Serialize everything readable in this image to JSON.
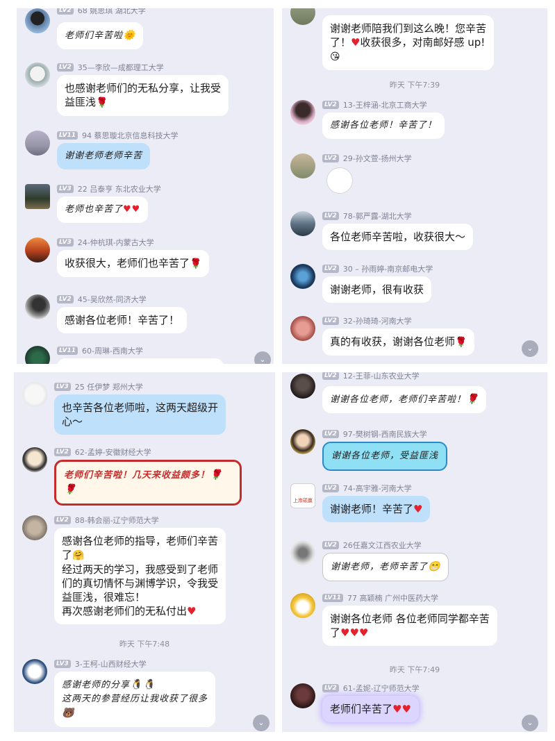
{
  "icons": {
    "heart": "♥",
    "rose": "🌹",
    "chevron": "⌄"
  },
  "panels": [
    {
      "messages": [
        {
          "level": "LV2",
          "name": "68 姚思琪 湖北大学",
          "text": "老师们辛苦啦",
          "emoji": "🌞"
        },
        {
          "level": "LV2",
          "name": "35—李欣—成都理工大学",
          "text": "也感谢老师们的无私分享，让我受\n益匪浅"
        },
        {
          "level": "LV11",
          "name": "94 蔡思璇北京信息科技大学",
          "text": "谢谢老师老师辛苦"
        },
        {
          "level": "LV3",
          "name": "22 吕泰亨 东北农业大学",
          "text": "老师也辛苦了"
        },
        {
          "level": "LV3",
          "name": "24-仲杭琪-内蒙古大学",
          "text": "收获很大，老师们也辛苦了"
        },
        {
          "level": "LV2",
          "name": "45-吴欣然-同济大学",
          "text": "感谢各位老师！辛苦了！"
        },
        {
          "level": "LV11",
          "name": "60-周琳-西南大学",
          "text": ""
        }
      ]
    },
    {
      "messages": [
        {
          "text": "谢谢老师陪我们到这么晚！您辛苦\n了！",
          "text2": "收获很多，对南邮好感 up!",
          "emoji": "😘"
        },
        {
          "level": "LV2",
          "name": "13-王梓涵-北京工商大学",
          "text": "感谢各位老师！辛苦了！"
        },
        {
          "level": "LV2",
          "name": "29-孙文萱-扬州大学",
          "text": ""
        },
        {
          "level": "LV2",
          "name": "78-郭严露-湖北大学",
          "text": "各位老师辛苦啦，收获很大～"
        },
        {
          "level": "LV2",
          "name": "30 – 孙雨婷-南京邮电大学",
          "text": "谢谢老师，很有收获"
        },
        {
          "level": "LV2",
          "name": "32-孙琦琦-河南大学",
          "text": "真的有收获，谢谢各位老师"
        }
      ],
      "time": "昨天 下午7:39"
    },
    {
      "messages": [
        {
          "level": "LV3",
          "name": "25 任伊梦 郑州大学",
          "text": "也辛苦各位老师啦，这两天超级开\n心～"
        },
        {
          "level": "LV2",
          "name": "62-孟婷-安徽财经大学",
          "text": "老师们辛苦啦！几天来收益颇多！"
        },
        {
          "level": "LV2",
          "name": "88-韩会丽-辽宁师范大学",
          "text": "感谢各位老师的指导，老师们辛苦\n了",
          "emoji": "🤗",
          "text2": "经过两天的学习，我感受到了老师\n们的真切情怀与渊博学识，令我受\n益匪浅，很难忘！",
          "text3": "再次感谢老师们的无私付出"
        },
        {
          "level": "LV3",
          "name": "3-王柯-山西财经大学",
          "text": "感谢老师的分享",
          "emoji": "🐧🐧",
          "text2": "这两天的参营经历让我收获了很多",
          "emoji2": "🐻"
        }
      ],
      "time": "昨天 下午7:48"
    },
    {
      "messages": [
        {
          "level": "LV2",
          "name": "12-王菲-山东农业大学",
          "text": "谢谢各位老师，老师们辛苦啦！"
        },
        {
          "level": "LV2",
          "name": "97-樊树钢-西南民族大学",
          "text": "谢谢各位老师，受益匪浅"
        },
        {
          "level": "LV2",
          "name": "74-高宇雅-河南大学",
          "text": "谢谢老师！辛苦了",
          "avatar_text": "上岸硕赢"
        },
        {
          "level": "LV2",
          "name": "26任嘉文江西农业大学",
          "text": "谢谢老师，老师辛苦了",
          "emoji": "😁"
        },
        {
          "level": "LV11",
          "name": "77 高颖楠 广州中医药大学",
          "text": "谢谢各位老师 各位老师同学都辛苦\n了"
        },
        {
          "level": "LV2",
          "name": "61-孟妮-辽宁师范大学",
          "text": "老师们辛苦了"
        }
      ],
      "time": "昨天 下午7:49"
    }
  ]
}
